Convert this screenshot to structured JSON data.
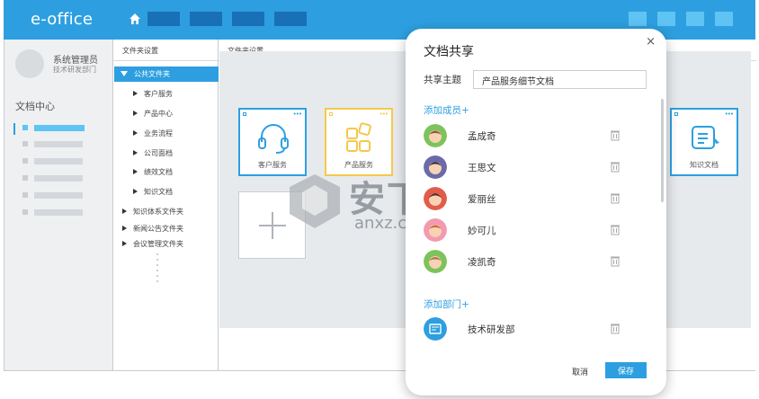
{
  "app": {
    "title": "e-office"
  },
  "user": {
    "name": "系统管理员",
    "dept": "技术研发部门"
  },
  "sidebar": {
    "section_title": "文档中心"
  },
  "folders": {
    "header": "文件夹设置",
    "selected": "公共文件夹",
    "children": [
      "客户服务",
      "产品中心",
      "业务流程",
      "公司面档",
      "绩效文档",
      "知识文档"
    ],
    "others": [
      "知识体系文件夹",
      "新闻公告文件夹",
      "会议管理文件夹"
    ]
  },
  "main": {
    "header": "文件夹设置",
    "cards": [
      {
        "label": "客户服务",
        "icon": "headset-icon"
      },
      {
        "label": "产品服务",
        "icon": "blocks-icon"
      },
      {
        "label": "知识文档",
        "icon": "document-icon"
      }
    ]
  },
  "watermark": {
    "text": "安下载",
    "sub": "anxz.com"
  },
  "dialog": {
    "title": "文档共享",
    "close": "×",
    "subject_label": "共享主题",
    "subject_value": "产品服务细节文档",
    "add_members": "添加成员+",
    "members": [
      "孟成奇",
      "王思文",
      "爱丽丝",
      "妙可儿",
      "凌凯奇"
    ],
    "add_departments": "添加部门+",
    "departments": [
      "技术研发部"
    ],
    "cancel": "取消",
    "save": "保存"
  },
  "colors": {
    "brand": "#2d9fe0",
    "accent_yellow": "#f5c84a",
    "nav_dark": "#1a70b6"
  }
}
